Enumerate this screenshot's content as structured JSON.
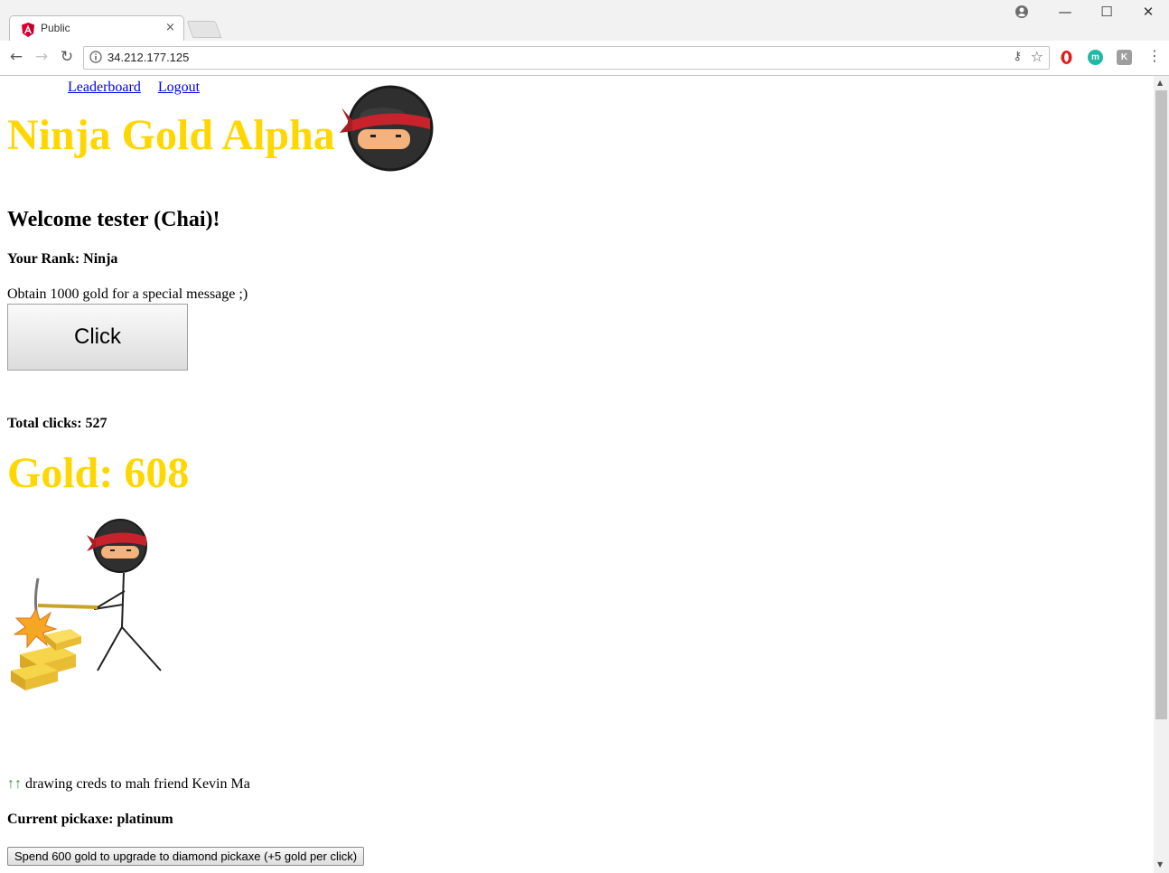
{
  "browser": {
    "tab_title": "Public",
    "tab_close": "×",
    "url": "34.212.177.125",
    "window_controls": {
      "minimize": "—",
      "maximize": "☐",
      "close": "✕"
    },
    "nav": {
      "back": "←",
      "forward": "→",
      "reload": "↻"
    },
    "menu_glyph": "⋮",
    "star_glyph": "☆",
    "key_glyph": "⚷",
    "extensions": [
      {
        "name": "opera-extension-icon",
        "label": "",
        "color": "#e31b1b"
      },
      {
        "name": "m-extension-icon",
        "label": "m",
        "color": "#1fb8a6"
      },
      {
        "name": "k-extension-icon",
        "label": "K",
        "color": "#9e9e9e"
      }
    ],
    "colors": {
      "angular_favicon": "#dd0031",
      "link": "#0000ee"
    }
  },
  "page": {
    "nav_links": {
      "leaderboard": "Leaderboard",
      "logout": "Logout"
    },
    "title": "Ninja Gold Alpha",
    "title_color": "#ffd700",
    "welcome": "Welcome tester (Chai)!",
    "rank": "Your Rank: Ninja",
    "message": "Obtain 1000 gold for a special message ;)",
    "click_button": "Click",
    "total_clicks": "Total clicks: 527",
    "gold": "Gold: 608",
    "credit_arrows": "↑↑",
    "credit_text": " drawing creds to mah friend Kevin Ma",
    "pickaxe": "Current pickaxe: platinum",
    "upgrade_button": "Spend 600 gold to upgrade to diamond pickaxe (+5 gold per click)"
  }
}
